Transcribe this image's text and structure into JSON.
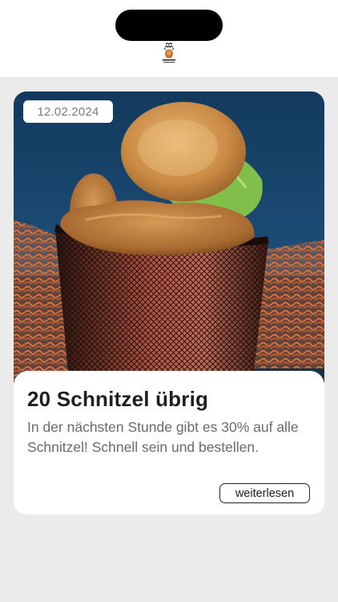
{
  "post": {
    "date": "12.02.2024",
    "title": "20 Schnitzel übrig",
    "text": "In der nächsten Stunde gibt es 30% auf alle Schnitzel! Schnell sein und bestellen.",
    "read_more_label": "weiterlesen",
    "image_icon": "schnitzel-photo"
  },
  "header": {
    "logo_icon": "restaurant-logo-icon"
  },
  "colors": {
    "page_background": "#ebebeb",
    "header_background": "#ffffff",
    "card_background": "#ffffff",
    "title_text": "#1f1f1f",
    "body_text": "#6b6b6b",
    "date_text": "#7a7a7a"
  }
}
